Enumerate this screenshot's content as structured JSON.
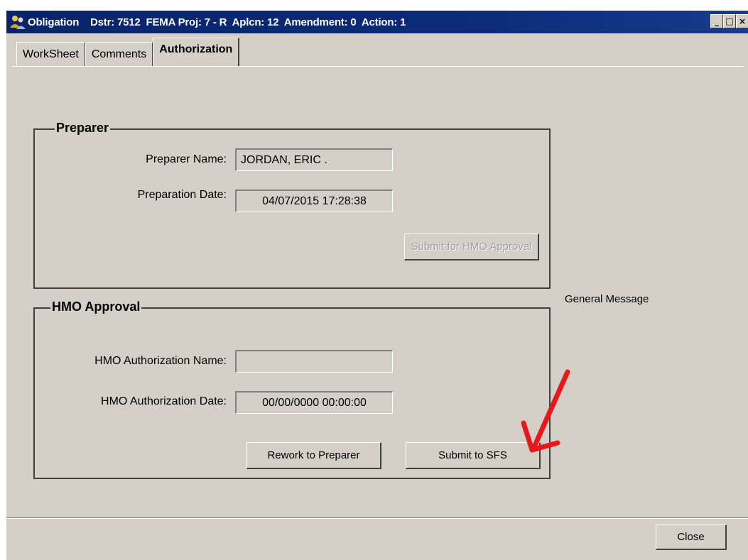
{
  "window": {
    "title": "Obligation    Dstr: 7512  FEMA Proj: 7 - R  Aplcn: 12  Amendment: 0  Action: 1",
    "icon": "people-icon",
    "controls": [
      "minimize",
      "maximize",
      "close"
    ]
  },
  "tabs": [
    {
      "label": "WorkSheet",
      "active": false
    },
    {
      "label": "Comments",
      "active": false
    },
    {
      "label": "Authorization",
      "active": true
    }
  ],
  "preparer": {
    "legend": "Preparer",
    "name_label": "Preparer Name:",
    "name_value": "JORDAN, ERIC .",
    "date_label": "Preparation Date:",
    "date_value": "04/07/2015 17:28:38",
    "submit_button": "Submit for HMO Approval"
  },
  "hmo": {
    "legend": "HMO Approval",
    "name_label": "HMO Authorization Name:",
    "name_value": "",
    "date_label": "HMO Authorization Date:",
    "date_value": "00/00/0000 00:00:00",
    "rework_button": "Rework to Preparer",
    "submit_button": "Submit to SFS"
  },
  "general_message": "General Message",
  "close_button": "Close",
  "annotation_color": "#e8171a"
}
